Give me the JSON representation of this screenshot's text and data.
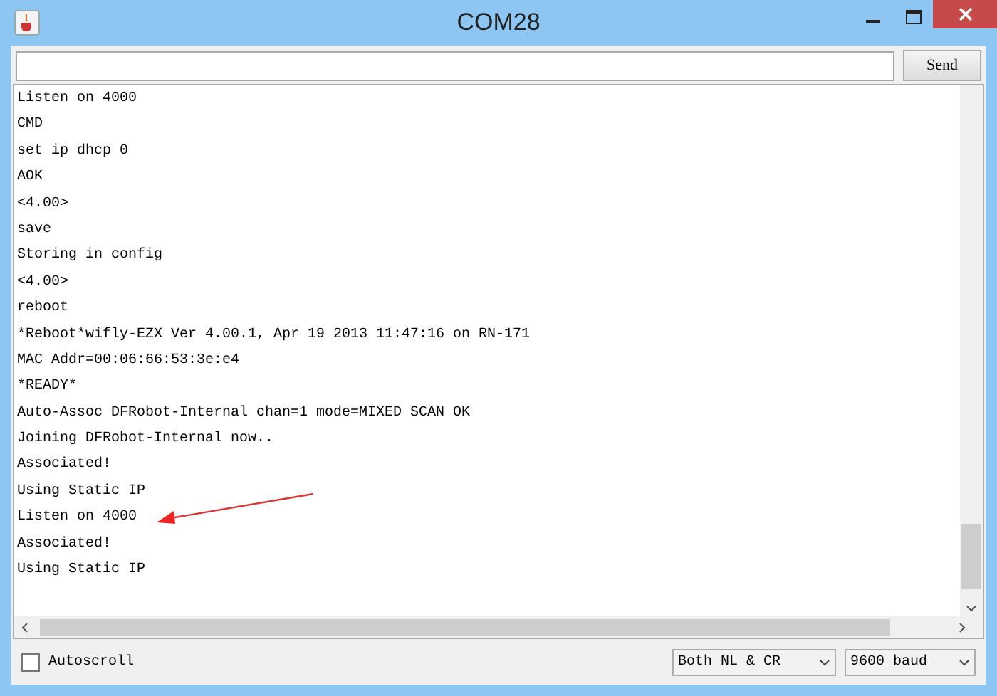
{
  "window": {
    "title": "COM28"
  },
  "send_button": "Send",
  "output_lines": [
    "Listen on 4000",
    "CMD",
    "set ip dhcp 0",
    "AOK",
    "<4.00>",
    "save",
    "Storing in config",
    "<4.00>",
    "reboot",
    "*Reboot*wifly-EZX Ver 4.00.1, Apr 19 2013 11:47:16 on RN-171",
    "MAC Addr=00:06:66:53:3e:e4",
    "*READY*",
    "Auto-Assoc DFRobot-Internal chan=1 mode=MIXED SCAN OK",
    "Joining DFRobot-Internal now..",
    "Associated!",
    "Using Static IP",
    "Listen on 4000",
    "Associated!",
    "Using Static IP"
  ],
  "autoscroll": {
    "label": "Autoscroll",
    "checked": false
  },
  "line_ending": "Both NL & CR",
  "baud_rate": "9600 baud"
}
